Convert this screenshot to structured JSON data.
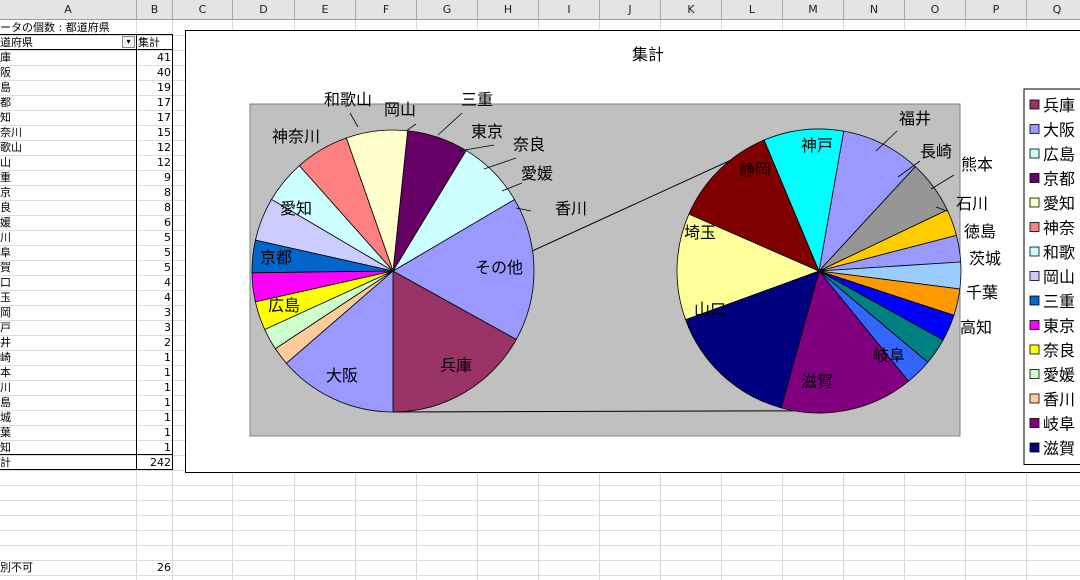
{
  "sheet": {
    "columns": [
      "A",
      "B",
      "C",
      "D",
      "E",
      "F",
      "G",
      "H",
      "I",
      "J",
      "K",
      "L",
      "M",
      "N",
      "O",
      "P",
      "Q"
    ],
    "pivot_title": "ータの個数 : 都道府県",
    "header_a": "道府県",
    "header_b": "集計",
    "rows": [
      {
        "a": "庫",
        "b": "41"
      },
      {
        "a": "阪",
        "b": "40"
      },
      {
        "a": "島",
        "b": "19"
      },
      {
        "a": "都",
        "b": "17"
      },
      {
        "a": "知",
        "b": "17"
      },
      {
        "a": "奈川",
        "b": "15"
      },
      {
        "a": "歌山",
        "b": "12"
      },
      {
        "a": "山",
        "b": "12"
      },
      {
        "a": "重",
        "b": "9"
      },
      {
        "a": "京",
        "b": "8"
      },
      {
        "a": "良",
        "b": "8"
      },
      {
        "a": "媛",
        "b": "6"
      },
      {
        "a": "川",
        "b": "5"
      },
      {
        "a": "阜",
        "b": "5"
      },
      {
        "a": "賀",
        "b": "5"
      },
      {
        "a": "口",
        "b": "4"
      },
      {
        "a": "玉",
        "b": "4"
      },
      {
        "a": "岡",
        "b": "3"
      },
      {
        "a": "戸",
        "b": "3"
      },
      {
        "a": "井",
        "b": "2"
      },
      {
        "a": "崎",
        "b": "1"
      },
      {
        "a": "本",
        "b": "1"
      },
      {
        "a": "川",
        "b": "1"
      },
      {
        "a": "島",
        "b": "1"
      },
      {
        "a": "城",
        "b": "1"
      },
      {
        "a": "葉",
        "b": "1"
      },
      {
        "a": "知",
        "b": "1"
      }
    ],
    "total_label": "計",
    "total_value": "242",
    "extra_label": "別不可",
    "extra_value": "26"
  },
  "chart_data": {
    "type": "pie",
    "title": "集計",
    "main_pie": {
      "categories": [
        "兵庫",
        "大阪",
        "広島",
        "京都",
        "愛知",
        "神奈川",
        "和歌山",
        "岡山",
        "三重",
        "東京",
        "奈良",
        "愛媛",
        "香川",
        "その他"
      ],
      "values": [
        41,
        40,
        19,
        17,
        17,
        15,
        12,
        12,
        9,
        8,
        8,
        6,
        5,
        33
      ],
      "colors": [
        "#993366",
        "#9999ff",
        "#ccffff",
        "#660066",
        "#ffffcc",
        "#ff8080",
        "#ccffff",
        "#ccccff",
        "#0066cc",
        "#ff00ff",
        "#ffff00",
        "#ccffcc",
        "#ffcc99",
        "#9999ff"
      ]
    },
    "secondary_pie": {
      "categories": [
        "神戸",
        "福井",
        "長崎",
        "熊本",
        "石川",
        "徳島",
        "茨城",
        "千葉",
        "高知",
        "岐阜",
        "滋賀",
        "山口",
        "埼玉",
        "静岡"
      ],
      "values": [
        3,
        2,
        1,
        1,
        1,
        1,
        1,
        1,
        1,
        5,
        5,
        4,
        4,
        3
      ],
      "colors": [
        "#9999ff",
        "#969696",
        "#ffcc00",
        "#9999ff",
        "#99ccff",
        "#ff9900",
        "#0000ff",
        "#008080",
        "#3366ff",
        "#800080",
        "#000080",
        "#ffff99",
        "#800000",
        "#00ffff"
      ]
    },
    "legend": {
      "position": "right",
      "items": [
        {
          "label": "兵庫",
          "color": "#993366"
        },
        {
          "label": "大阪",
          "color": "#9999ff"
        },
        {
          "label": "広島",
          "color": "#ccffff"
        },
        {
          "label": "京都",
          "color": "#660066"
        },
        {
          "label": "愛知",
          "color": "#ffffcc"
        },
        {
          "label": "神奈",
          "color": "#ff8080"
        },
        {
          "label": "和歌",
          "color": "#ccffff"
        },
        {
          "label": "岡山",
          "color": "#ccccff"
        },
        {
          "label": "三重",
          "color": "#0066cc"
        },
        {
          "label": "東京",
          "color": "#ff00ff"
        },
        {
          "label": "奈良",
          "color": "#ffff00"
        },
        {
          "label": "愛媛",
          "color": "#ccffcc"
        },
        {
          "label": "香川",
          "color": "#ffcc99"
        },
        {
          "label": "岐阜",
          "color": "#800080"
        },
        {
          "label": "滋賀",
          "color": "#000080"
        }
      ]
    },
    "plot_background": "#c0c0c0"
  }
}
